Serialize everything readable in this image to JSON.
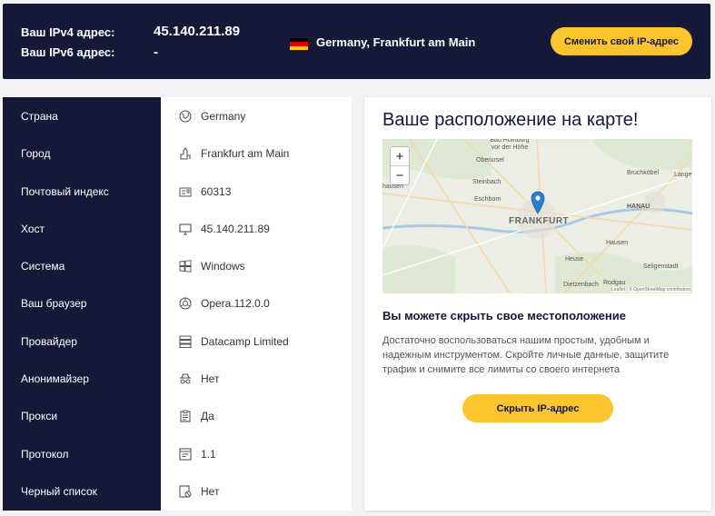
{
  "header": {
    "ipv4_label": "Ваш IPv4 адрес:",
    "ipv4_value": "45.140.211.89",
    "ipv6_label": "Ваш IPv6 адрес:",
    "ipv6_value": "-",
    "location": "Germany, Frankfurt am Main",
    "change_ip_button": "Сменить свой IP-адрес"
  },
  "info": {
    "rows": [
      {
        "label": "Страна",
        "value": "Germany",
        "icon": "globe-icon"
      },
      {
        "label": "Город",
        "value": "Frankfurt am Main",
        "icon": "city-icon"
      },
      {
        "label": "Почтовый индекс",
        "value": "60313",
        "icon": "postcode-icon"
      },
      {
        "label": "Хост",
        "value": "45.140.211.89",
        "icon": "monitor-icon"
      },
      {
        "label": "Система",
        "value": "Windows",
        "icon": "windows-icon"
      },
      {
        "label": "Ваш браузер",
        "value": "Opera.112.0.0",
        "icon": "browser-icon"
      },
      {
        "label": "Провайдер",
        "value": "Datacamp Limited",
        "icon": "server-icon"
      },
      {
        "label": "Анонимайзер",
        "value": "Нет",
        "icon": "incognito-icon"
      },
      {
        "label": "Прокси",
        "value": "Да",
        "icon": "clipboard-icon"
      },
      {
        "label": "Протокол",
        "value": "1.1",
        "icon": "protocol-icon"
      },
      {
        "label": "Черный список",
        "value": "Нет",
        "icon": "blacklist-icon"
      }
    ]
  },
  "map_card": {
    "title": "Ваше расположение на карте!",
    "zoom_in": "+",
    "zoom_out": "−",
    "map_labels": {
      "hofheim": "Bad Homburg vor der Höhe",
      "oberursel": "Oberursel",
      "steinbach": "Steinbach",
      "eschborn": "Eschborn",
      "frankfurt": "FRANKFURT",
      "hanau": "HANAU",
      "bruchkoebel": "Bruchköbel",
      "hausen": "Hausen",
      "heuse": "Heuse",
      "seligenstadt": "Seligenstadt",
      "dietzenbach": "Dietzenbach",
      "rodgau": "Rodgau",
      "hausen_left": "hausen",
      "lange": "Lange"
    },
    "attribution": "Leaflet | © OpenStreetMap contributors",
    "hide_heading": "Вы можете скрыть свое местоположение",
    "hide_text": "Достаточно воспользоваться нашим простым, удобным и надежным инструментом. Скройте личные данные, защитите трафик и снимите все лимиты со своего интернета",
    "hide_button": "Скрыть IP-адрес"
  },
  "colors": {
    "navy": "#161838",
    "accent": "#fcc42d",
    "marker": "#2a7fd4"
  }
}
